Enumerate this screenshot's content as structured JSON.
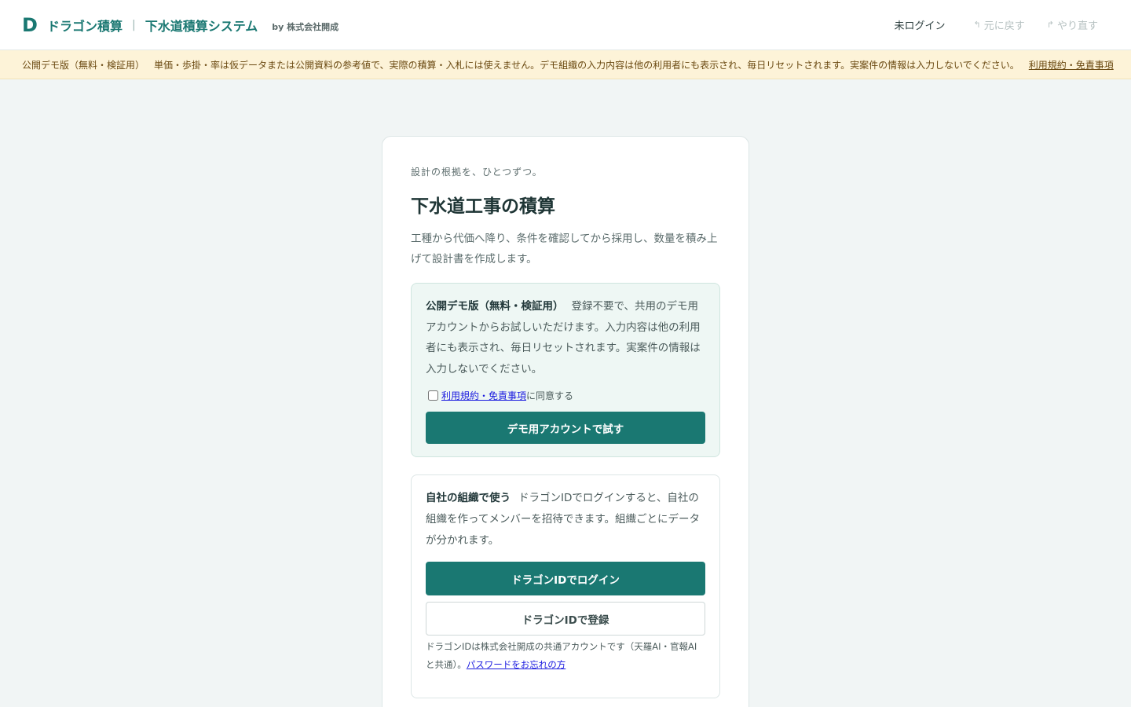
{
  "header": {
    "logo": "D",
    "brand": "ドラゴン積算",
    "separator": "|",
    "system": "下水道積算システム",
    "byline": "by 株式会社開成",
    "login_status": "未ログイン",
    "undo_label": "元に戻す",
    "redo_label": "やり直す",
    "undo_icon": "↰",
    "redo_icon": "↱"
  },
  "banner": {
    "title": "公開デモ版（無料・検証用）",
    "text": "単価・歩掛・率は仮データまたは公開資料の参考値で、実際の積算・入札には使えません。デモ組織の入力内容は他の利用者にも表示され、毎日リセットされます。実案件の情報は入力しないでください。",
    "link": "利用規約・免責事項"
  },
  "card": {
    "tagline": "設計の根拠を、ひとつずつ。",
    "title": "下水道工事の積算",
    "lead": "工種から代価へ降り、条件を確認してから採用し、数量を積み上げて設計書を作成します。",
    "demo": {
      "heading": "公開デモ版（無料・検証用）",
      "text": "登録不要で、共用のデモ用アカウントからお試しいただけます。入力内容は他の利用者にも表示され、毎日リセットされます。実案件の情報は入力しないでください。",
      "agree_link": "利用規約・免責事項",
      "agree_suffix": "に同意する",
      "button": "デモ用アカウントで試す"
    },
    "org": {
      "heading": "自社の組織で使う",
      "text": "ドラゴンIDでログインすると、自社の組織を作ってメンバーを招待できます。組織ごとにデータが分かれます。",
      "login_button": "ドラゴンIDでログイン",
      "register_button": "ドラゴンIDで登録",
      "note": "ドラゴンIDは株式会社開成の共通アカウントです（天羅AI・官報AI と共通）。",
      "forgot_link": "パスワードをお忘れの方"
    }
  }
}
